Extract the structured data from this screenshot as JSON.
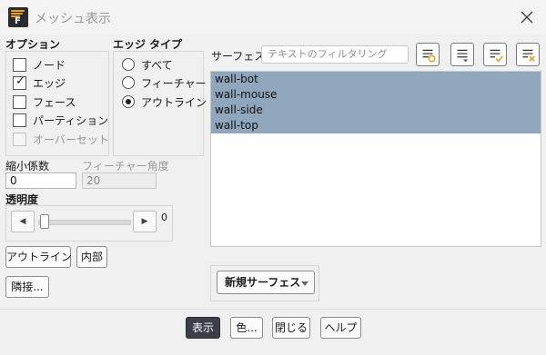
{
  "window": {
    "title": "メッシュ表示",
    "close_icon": "close-icon"
  },
  "options": {
    "heading": "オプション",
    "items": [
      {
        "label": "ノード",
        "checked": false,
        "disabled": false
      },
      {
        "label": "エッジ",
        "checked": true,
        "disabled": false
      },
      {
        "label": "フェース",
        "checked": false,
        "disabled": false
      },
      {
        "label": "パーティション",
        "checked": false,
        "disabled": false
      },
      {
        "label": "オーバーセット",
        "checked": false,
        "disabled": true
      }
    ]
  },
  "edge_type": {
    "heading": "エッジ タイプ",
    "items": [
      {
        "label": "すべて",
        "selected": false
      },
      {
        "label": "フィーチャー",
        "selected": false
      },
      {
        "label": "アウトライン",
        "selected": true
      }
    ]
  },
  "shrink": {
    "label": "縮小係数",
    "value": "0"
  },
  "feature_angle": {
    "label": "フィーチャー角度",
    "value": "20"
  },
  "transparency": {
    "label": "透明度",
    "value": "0",
    "fraction": 0.0
  },
  "buttons": {
    "outline": "アウトライン",
    "interior": "内部",
    "adjacency": "隣接..."
  },
  "surfaces": {
    "label": "サーフェス",
    "filter_placeholder": "テキストのフィルタリング",
    "items": [
      "wall-bot",
      "wall-mouse",
      "wall-side",
      "wall-top"
    ],
    "new_surface": "新規サーフェス"
  },
  "footer": {
    "display": "表示",
    "colors": "色...",
    "close": "閉じる",
    "help": "ヘルプ"
  }
}
